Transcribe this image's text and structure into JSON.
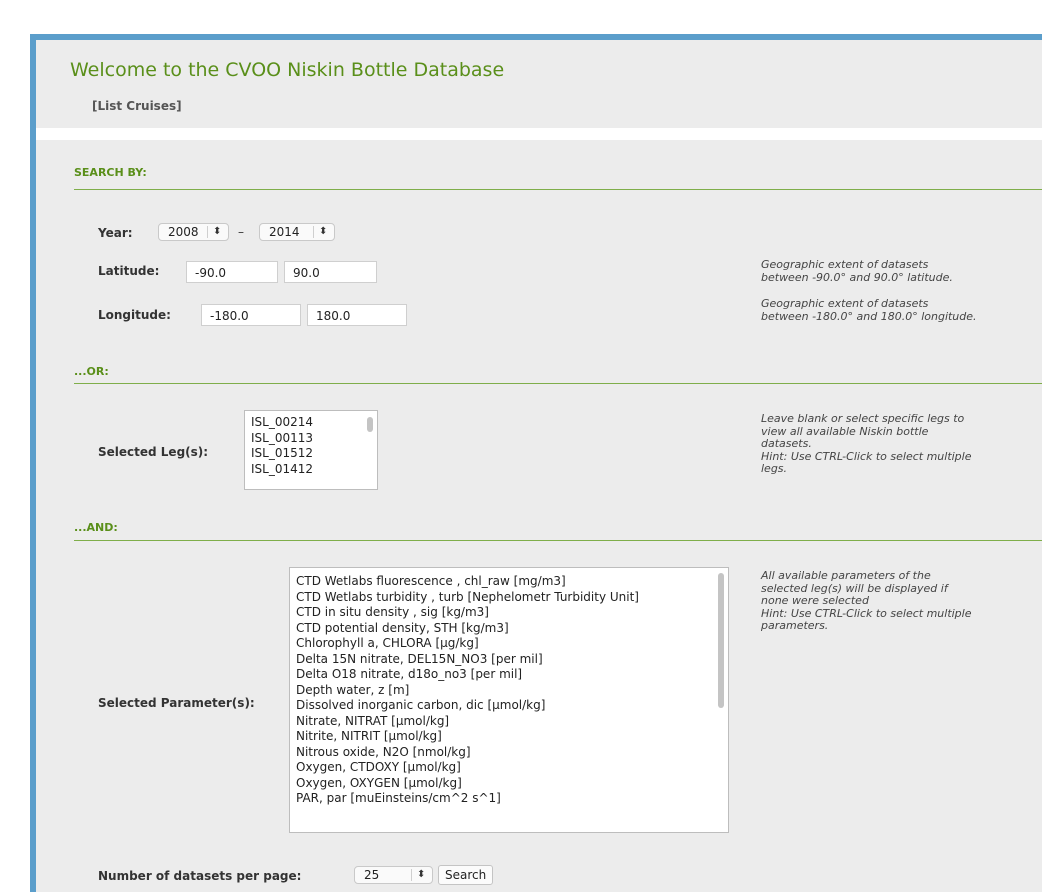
{
  "header": {
    "title": "Welcome to the CVOO Niskin Bottle Database",
    "list_cruises": "[List Cruises]"
  },
  "search_by": {
    "heading": "SEARCH BY:",
    "year": {
      "label": "Year:",
      "from": "2008",
      "dash": "–",
      "to": "2014"
    },
    "latitude": {
      "label": "Latitude:",
      "min": "-90.0",
      "max": "90.0",
      "note_1": "Geographic extent of datasets",
      "note_2": "between -90.0° and 90.0° latitude."
    },
    "longitude": {
      "label": "Longitude:",
      "min": "-180.0",
      "max": "180.0",
      "note_1": "Geographic extent of datasets",
      "note_2": "between -180.0° and 180.0° longitude."
    }
  },
  "or_section": {
    "heading": "...OR:",
    "legs_label": "Selected Leg(s):",
    "legs": [
      "ISL_00214",
      "ISL_00113",
      "ISL_01512",
      "ISL_01412"
    ],
    "note": [
      "Leave blank or select specific legs to",
      "view all available Niskin bottle",
      "datasets.",
      "Hint: Use CTRL-Click to select multiple",
      "legs."
    ]
  },
  "and_section": {
    "heading": "...AND:",
    "params_label": "Selected Parameter(s):",
    "parameters": [
      "CTD Wetlabs fluorescence , chl_raw [mg/m3]",
      "CTD Wetlabs turbidity , turb [Nephelometr Turbidity Unit]",
      "CTD in situ density , sig [kg/m3]",
      "CTD potential density, STH [kg/m3]",
      "Chlorophyll a, CHLORA [µg/kg]",
      "Delta 15N nitrate, DEL15N_NO3 [per mil]",
      "Delta O18 nitrate, d18o_no3 [per mil]",
      "Depth water, z [m]",
      "Dissolved inorganic carbon, dic [µmol/kg]",
      "Nitrate, NITRAT [µmol/kg]",
      "Nitrite, NITRIT [µmol/kg]",
      "Nitrous oxide, N2O [nmol/kg]",
      "Oxygen, CTDOXY [µmol/kg]",
      "Oxygen, OXYGEN [µmol/kg]",
      "PAR, par [muEinsteins/cm^2 s^1]"
    ],
    "note": [
      "All available parameters of the",
      "selected leg(s) will be displayed if",
      "none were selected",
      "Hint: Use CTRL-Click to select multiple",
      "parameters."
    ]
  },
  "footer": {
    "per_page_label": "Number of datasets per page:",
    "per_page_value": "25",
    "search_button": "Search"
  },
  "colors": {
    "accent_green": "#5a8f1a",
    "frame_blue": "#5b9ecb"
  }
}
